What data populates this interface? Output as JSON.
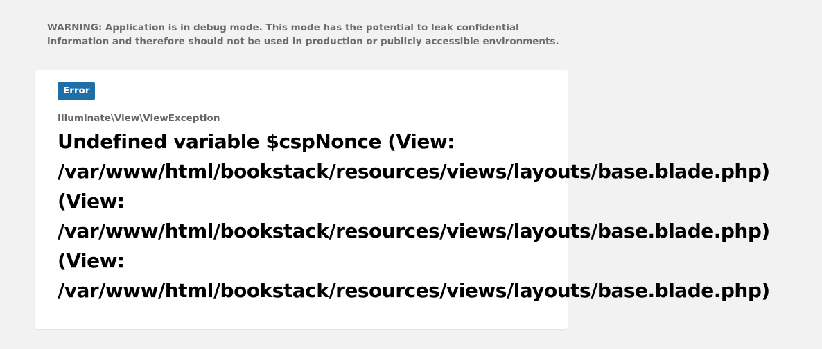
{
  "warning": {
    "line1": "WARNING: Application is in debug mode. This mode has the potential to leak confidential",
    "line2": "information and therefore should not be used in production or publicly accessible environments."
  },
  "error": {
    "badge_label": "Error",
    "exception_class": "Illuminate\\View\\ViewException",
    "message_lines": [
      "Undefined variable $cspNonce (View:",
      "/var/www/html/bookstack/resources/views/layouts/base.blade.php)",
      "(View:",
      "/var/www/html/bookstack/resources/views/layouts/base.blade.php)",
      "(View:",
      "/var/www/html/bookstack/resources/views/layouts/base.blade.php)"
    ]
  },
  "colors": {
    "background": "#f2f2f2",
    "card": "#ffffff",
    "badge": "#206ea7",
    "warning_text": "#6b6b6b"
  }
}
